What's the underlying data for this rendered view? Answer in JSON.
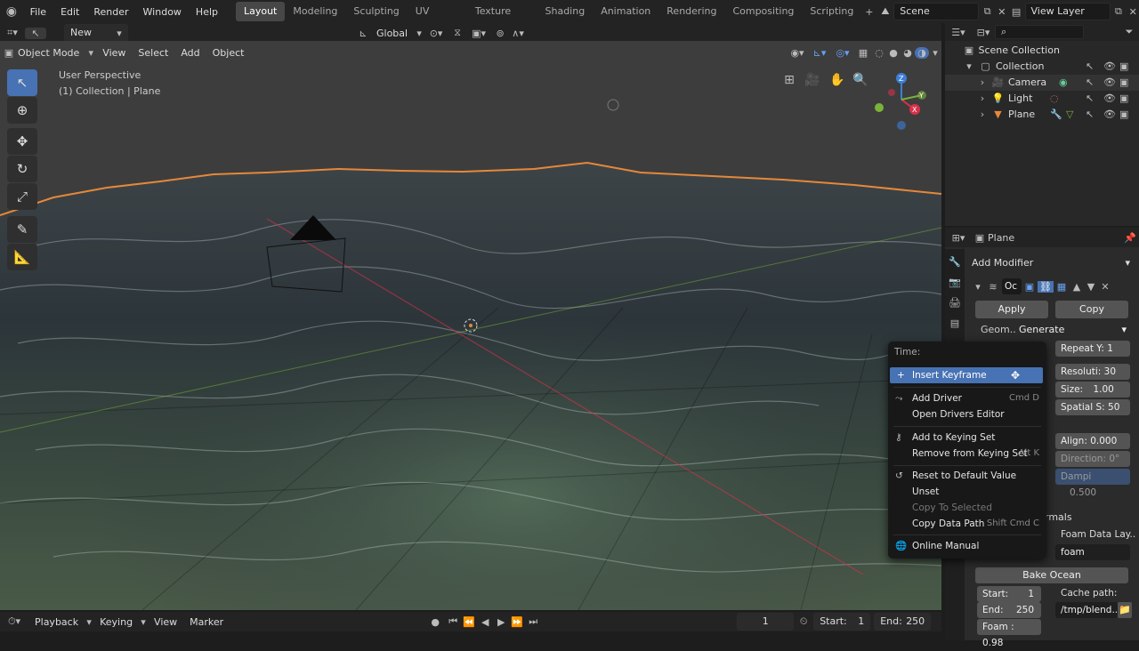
{
  "topbar": {
    "menus": [
      "File",
      "Edit",
      "Render",
      "Window",
      "Help"
    ],
    "workspaces": [
      "Layout",
      "Modeling",
      "Sculpting",
      "UV Editing",
      "Texture Paint",
      "Shading",
      "Animation",
      "Rendering",
      "Compositing",
      "Scripting"
    ],
    "active_workspace": "Layout",
    "scene": "Scene",
    "view_layer": "View Layer"
  },
  "viewport_header": {
    "new_label": "New",
    "orientation": "Global"
  },
  "viewport_bar": {
    "mode": "Object Mode",
    "menus": [
      "View",
      "Select",
      "Add",
      "Object"
    ]
  },
  "overlay": {
    "line1": "User Perspective",
    "line2": "(1) Collection | Plane"
  },
  "gizmo": {
    "x": "X",
    "y": "Y",
    "z": "Z"
  },
  "outliner": {
    "root": "Scene Collection",
    "collection": "Collection",
    "items": [
      "Camera",
      "Light",
      "Plane"
    ]
  },
  "properties": {
    "object_name": "Plane",
    "add_modifier": "Add Modifier",
    "modifier_short": "Oc",
    "apply": "Apply",
    "copy": "Copy",
    "geometry_label": "Geom..",
    "geometry_value": "Generate",
    "repeat_y": "Repeat Y:",
    "repeat_y_val": "1",
    "resolution": "Resoluti:",
    "resolution_val": "30",
    "size": "Size:",
    "size_val": "1.00",
    "spatial": "Spatial S:",
    "spatial_val": "50",
    "align": "Align:",
    "align_val": "0.000",
    "direction": "Direction:",
    "direction_val": "0°",
    "damp": "Dampi",
    "damp_val": "0.500",
    "normals": "rmals",
    "foam_layer_label": "Foam Data Lay..",
    "foam_layer_val": "foam",
    "bake": "Bake Ocean",
    "start": "Start:",
    "start_val": "1",
    "end": "End:",
    "end_val": "250",
    "cache_label": "Cache path:",
    "cache_val": "/tmp/blend..",
    "foam": "Foam :",
    "foam_val": "0.98"
  },
  "context_menu": {
    "title": "Time:",
    "insert_keyframe": "Insert Keyframe",
    "add_driver": "Add Driver",
    "add_driver_sc": "Cmd D",
    "open_drivers": "Open Drivers Editor",
    "add_keying": "Add to Keying Set",
    "remove_keying": "Remove from Keying Set",
    "remove_keying_sc": "Alt K",
    "reset_default": "Reset to Default Value",
    "unset": "Unset",
    "copy_selected": "Copy To Selected",
    "copy_path": "Copy Data Path",
    "copy_path_sc": "Shift Cmd C",
    "online_manual": "Online Manual"
  },
  "timeline": {
    "menus": [
      "Playback",
      "Keying",
      "View",
      "Marker"
    ],
    "current_frame": "1",
    "start_label": "Start:",
    "start": "1",
    "end_label": "End:",
    "end": "250"
  },
  "colors": {
    "accent": "#4772b3",
    "orange": "#e5883a",
    "x_axis": "#d9304a",
    "y_axis": "#7ab339",
    "z_axis": "#3d7fd6"
  }
}
